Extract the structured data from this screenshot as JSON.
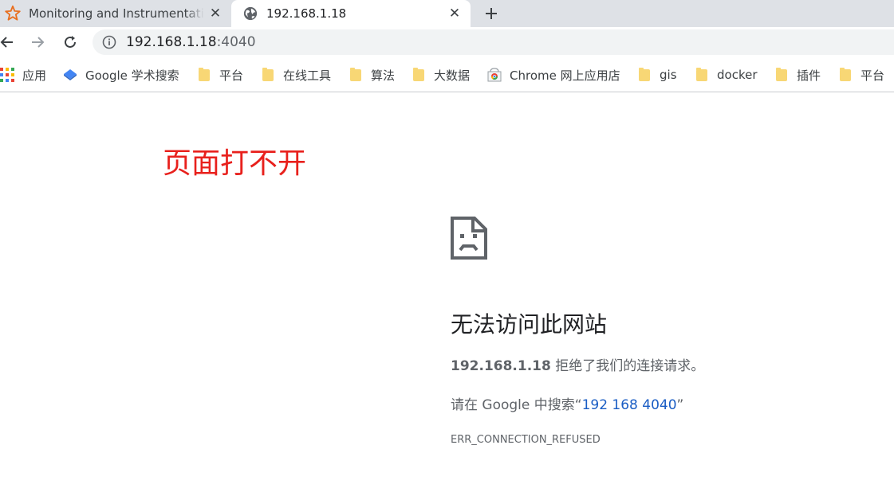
{
  "tabs": [
    {
      "title": "Monitoring and Instrumentation",
      "favicon": "spark-star-icon",
      "active": false
    },
    {
      "title": "192.168.1.18",
      "favicon": "globe-icon",
      "active": true
    }
  ],
  "toolbar": {
    "url_host": "192.168.1.18",
    "url_port": ":4040"
  },
  "bookmarks": [
    {
      "label": "应用",
      "icon": "apps-grid-icon"
    },
    {
      "label": "Google 学术搜索",
      "icon": "scholar-icon"
    },
    {
      "label": "平台",
      "icon": "folder-icon"
    },
    {
      "label": "在线工具",
      "icon": "folder-icon"
    },
    {
      "label": "算法",
      "icon": "folder-icon"
    },
    {
      "label": "大数据",
      "icon": "folder-icon"
    },
    {
      "label": "Chrome 网上应用店",
      "icon": "chrome-webstore-icon"
    },
    {
      "label": "gis",
      "icon": "folder-icon"
    },
    {
      "label": "docker",
      "icon": "folder-icon"
    },
    {
      "label": "插件",
      "icon": "folder-icon"
    },
    {
      "label": "平台",
      "icon": "folder-icon"
    }
  ],
  "annotation": "页面打不开",
  "error": {
    "heading": "无法访问此网站",
    "host": "192.168.1.18",
    "refused_text": " 拒绝了我们的连接请求。",
    "search_prefix": "请在 Google 中搜索“",
    "search_link": "192 168 4040",
    "search_suffix": "”",
    "code": "ERR_CONNECTION_REFUSED"
  },
  "colors": {
    "annotation": "#e8201c",
    "link": "#1a5dc4",
    "folder": "#f8d775",
    "tabstrip": "#dee1e6"
  }
}
